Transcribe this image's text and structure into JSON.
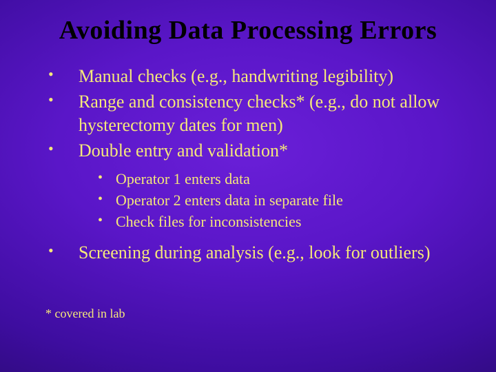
{
  "title": "Avoiding Data Processing Errors",
  "bullets": {
    "b1": "Manual checks (e.g., handwriting legibility)",
    "b2": "Range and consistency checks* (e.g., do not allow hysterectomy dates for men)",
    "b3": "Double entry and validation*",
    "b4": "Screening during analysis (e.g., look for outliers)"
  },
  "sub": {
    "s1": "Operator 1 enters data",
    "s2": "Operator 2 enters data in separate file",
    "s3": "Check files for inconsistencies"
  },
  "footnote": "* covered in lab"
}
